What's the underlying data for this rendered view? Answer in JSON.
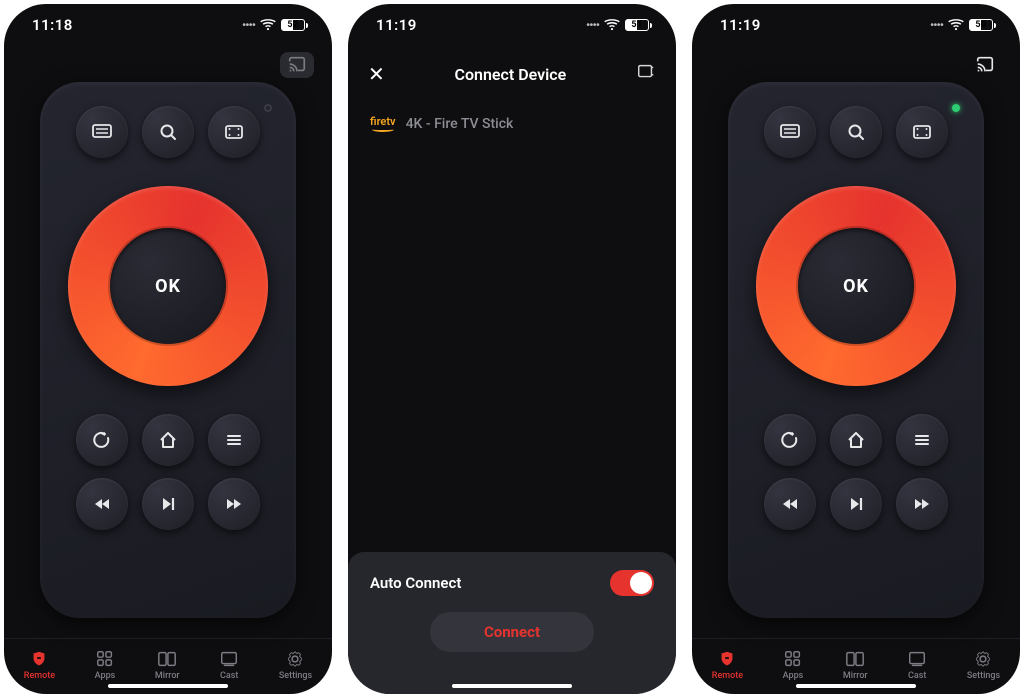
{
  "screen1": {
    "time": "11:18",
    "battery": "52",
    "connected": false
  },
  "screen2": {
    "time": "11:19",
    "battery": "51",
    "header_title": "Connect Device",
    "device_name": "4K - Fire TV Stick",
    "device_brand": "firetv",
    "auto_connect_label": "Auto Connect",
    "auto_connect_on": true,
    "connect_label": "Connect"
  },
  "screen3": {
    "time": "11:19",
    "battery": "50",
    "connected": true
  },
  "remote": {
    "ok_label": "OK"
  },
  "tabs": {
    "remote": "Remote",
    "apps": "Apps",
    "mirror": "Mirror",
    "cast": "Cast",
    "settings": "Settings"
  }
}
